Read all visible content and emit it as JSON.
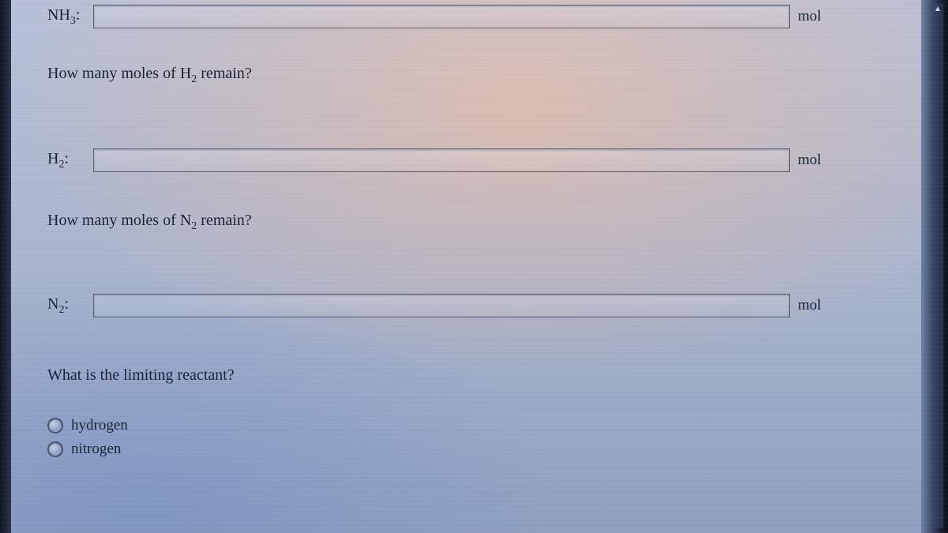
{
  "fields": {
    "nh3": {
      "label_base": "NH",
      "label_sub": "3",
      "unit": "mol",
      "value": ""
    },
    "h2": {
      "label_base": "H",
      "label_sub": "2",
      "unit": "mol",
      "value": ""
    },
    "n2": {
      "label_base": "N",
      "label_sub": "2",
      "unit": "mol",
      "value": ""
    }
  },
  "questions": {
    "q1": {
      "pre": "How many moles of H",
      "sub": "2",
      "post": " remain?"
    },
    "q2": {
      "pre": "How many moles of N",
      "sub": "2",
      "post": " remain?"
    },
    "q3": {
      "text": "What is the limiting reactant?"
    }
  },
  "options": {
    "hydrogen": "hydrogen",
    "nitrogen": "nitrogen"
  }
}
